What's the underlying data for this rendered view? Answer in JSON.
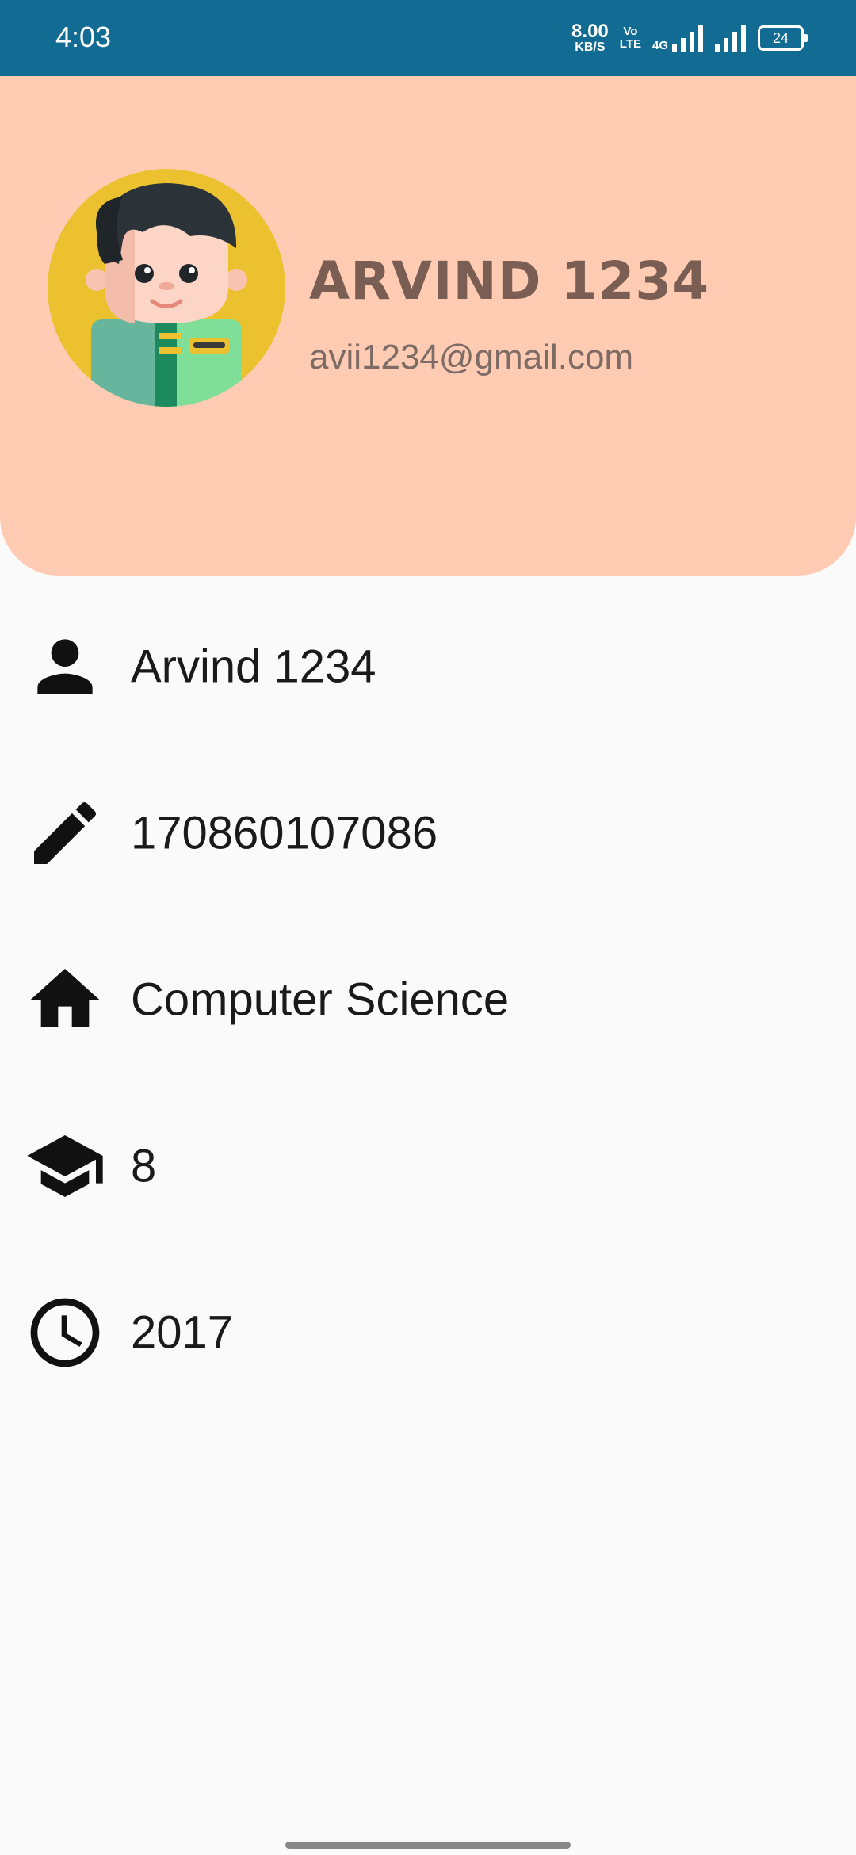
{
  "status_bar": {
    "time": "4:03",
    "network_speed_value": "8.00",
    "network_speed_unit": "KB/S",
    "volte_top": "Vo",
    "volte_bottom": "LTE",
    "network_type": "4G",
    "battery": "24",
    "background": "#126b93"
  },
  "profile": {
    "name": "ARVIND 1234",
    "email": "avii1234@gmail.com",
    "header_color": "#ffcbb2",
    "avatar": "student-avatar"
  },
  "details": [
    {
      "icon": "person-icon",
      "value": "Arvind 1234"
    },
    {
      "icon": "pencil-icon",
      "value": "170860107086"
    },
    {
      "icon": "home-icon",
      "value": "Computer Science"
    },
    {
      "icon": "graduation-cap-icon",
      "value": "8"
    },
    {
      "icon": "clock-icon",
      "value": "2017"
    }
  ]
}
